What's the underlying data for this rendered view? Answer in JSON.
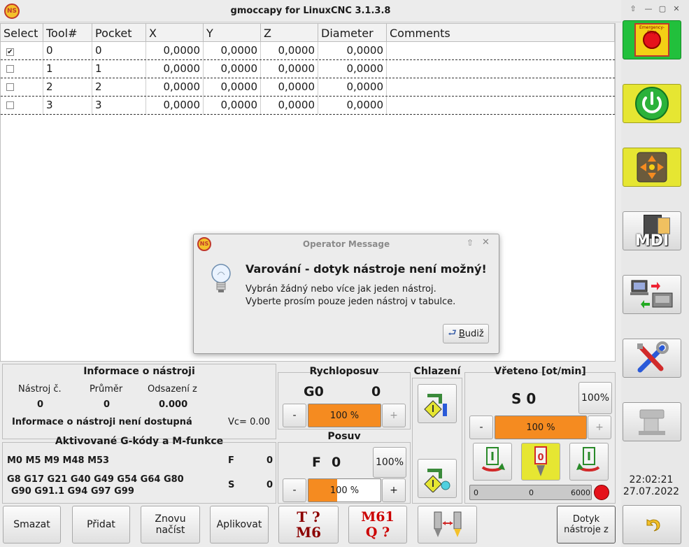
{
  "window": {
    "title": "gmoccapy for LinuxCNC  3.1.3.8",
    "logo_text": "NS"
  },
  "tool_table": {
    "columns": [
      "Select",
      "Tool#",
      "Pocket",
      "X",
      "Y",
      "Z",
      "Diameter",
      "Comments"
    ],
    "rows": [
      {
        "select": "✔",
        "tool": "0",
        "pocket": "0",
        "x": "0,0000",
        "y": "0,0000",
        "z": "0,0000",
        "diameter": "0,0000",
        "comments": ""
      },
      {
        "select": "",
        "tool": "1",
        "pocket": "1",
        "x": "0,0000",
        "y": "0,0000",
        "z": "0,0000",
        "diameter": "0,0000",
        "comments": ""
      },
      {
        "select": "",
        "tool": "2",
        "pocket": "2",
        "x": "0,0000",
        "y": "0,0000",
        "z": "0,0000",
        "diameter": "0,0000",
        "comments": ""
      },
      {
        "select": "",
        "tool": "3",
        "pocket": "3",
        "x": "0,0000",
        "y": "0,0000",
        "z": "0,0000",
        "diameter": "0,0000",
        "comments": ""
      }
    ]
  },
  "dialog": {
    "title": "Operator Message",
    "heading": "Varování - dotyk nástroje není možný!",
    "line1": "Vybrán žádný nebo více jak jeden nástroj.",
    "line2": "Vyberte prosím pouze jeden nástroj v tabulce.",
    "ok_label": "Budiž",
    "ok_mnemonic": "B",
    "ok_rest": "udiž"
  },
  "tool_info": {
    "title": "Informace o nástroji",
    "tool_no_label": "Nástroj č.",
    "diameter_label": "Průměr",
    "offset_label": "Odsazení z",
    "tool_no": "0",
    "diameter": "0",
    "offset": "0.000",
    "status": "Informace o nástroji není dostupná",
    "vc": "Vc= 0.00"
  },
  "gcodes": {
    "title": "Aktivované G-kódy a M-funkce",
    "mcodes": "M0 M5 M9 M48 M53",
    "f_label": "F",
    "f_value": "0",
    "gcodes_line1": "G8 G17 G21 G40 G49 G54 G64 G80",
    "gcodes_line2": "G90 G91.1 G94 G97 G99",
    "s_label": "S",
    "s_value": "0"
  },
  "rapid": {
    "title": "Rychloposuv",
    "code": "G0",
    "value": "0",
    "minus": "-",
    "plus": "+",
    "percent_text": "100 %",
    "percent": 100
  },
  "feed": {
    "title": "Posuv",
    "code": "F",
    "value": "0",
    "override_btn": "100%",
    "minus": "-",
    "plus": "+",
    "percent_text": "100 %",
    "percent": 40
  },
  "coolant": {
    "title": "Chlazení"
  },
  "spindle": {
    "title": "Vřeteno [ot/min]",
    "speed": "S 0",
    "override_btn": "100%",
    "minus": "-",
    "plus": "+",
    "percent_text": "100 %",
    "percent": 100,
    "scale_min": "0",
    "scale_mid": "0",
    "scale_max": "6000",
    "stop_digit": "0"
  },
  "bottom_buttons": {
    "delete": "Smazat",
    "add": "Přidat",
    "reload_1": "Znovu",
    "reload_2": "načíst",
    "apply": "Aplikovat",
    "t_line1": "T ?",
    "t_line2": "M6",
    "m61_line1": "M61",
    "m61_line2": "Q ?",
    "touch_1": "Dotyk",
    "touch_2": "nástroje z"
  },
  "sidebar": {
    "mdi_label": "MDI",
    "estop_text": "Emergency-Stop",
    "time": "22:02:21",
    "date": "27.07.2022"
  },
  "colors": {
    "accent_orange": "#f58b20",
    "estop_green": "#22c03c",
    "highlight_yellow": "#e6e632",
    "mcode_red": "#cc0000",
    "tcode_darkred": "#8b0000"
  }
}
